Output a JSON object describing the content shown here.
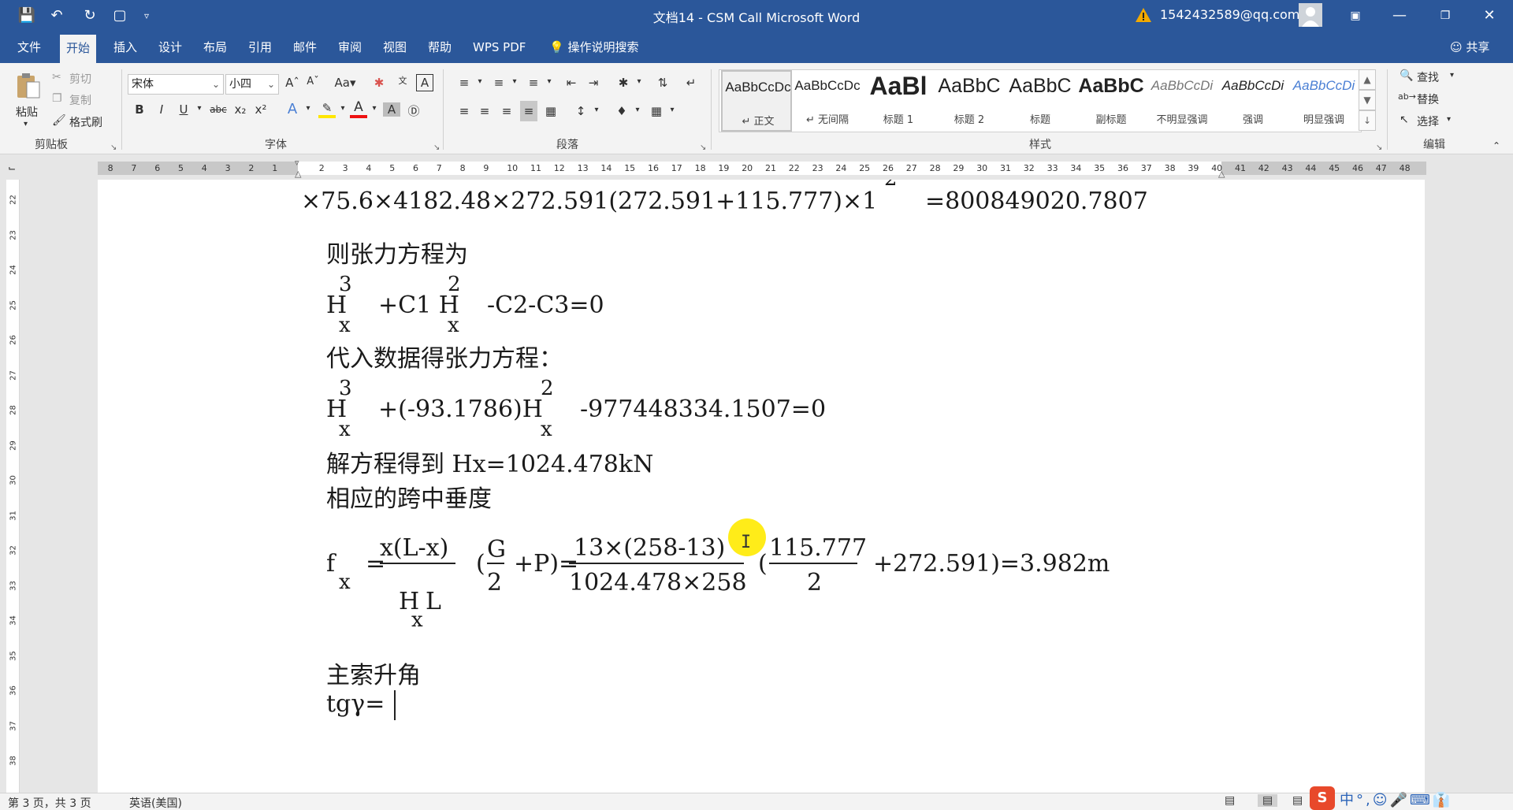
{
  "window": {
    "title": "文档14  -  CSM Call Microsoft Word",
    "account_email": "1542432589@qq.com",
    "quick_access": [
      "save",
      "undo",
      "redo",
      "new",
      "customize"
    ]
  },
  "ribbon_tabs": [
    "文件",
    "开始",
    "插入",
    "设计",
    "布局",
    "引用",
    "邮件",
    "审阅",
    "视图",
    "帮助",
    "WPS PDF"
  ],
  "active_tab": "开始",
  "tell_me": "操作说明搜索",
  "share": "共享",
  "clipboard": {
    "paste": "粘贴",
    "cut": "剪切",
    "copy": "复制",
    "format_painter": "格式刷",
    "label": "剪贴板"
  },
  "font": {
    "name": "宋体",
    "size": "小四",
    "label": "字体"
  },
  "paragraph": {
    "label": "段落"
  },
  "styles": {
    "label": "样式",
    "items": [
      {
        "sample": "AaBbCcDc",
        "name": "↵ 正文"
      },
      {
        "sample": "AaBbCcDc",
        "name": "↵ 无间隔"
      },
      {
        "sample": "AaBl",
        "name": "标题 1"
      },
      {
        "sample": "AaBbC",
        "name": "标题 2"
      },
      {
        "sample": "AaBbC",
        "name": "标题"
      },
      {
        "sample": "AaBbC",
        "name": "副标题"
      },
      {
        "sample": "AaBbCcDi",
        "name": "不明显强调"
      },
      {
        "sample": "AaBbCcDi",
        "name": "强调"
      },
      {
        "sample": "AaBbCcDi",
        "name": "明显强调"
      }
    ]
  },
  "editing": {
    "find": "查找",
    "replace": "替换",
    "select": "选择",
    "label": "编辑"
  },
  "ruler": {
    "h_left": [
      "8",
      "7",
      "6",
      "5",
      "4",
      "3",
      "2",
      "1"
    ],
    "h_right": [
      "2",
      "3",
      "4",
      "5",
      "6",
      "7",
      "8",
      "9",
      "10",
      "11",
      "12",
      "13",
      "14",
      "15",
      "16",
      "17",
      "18",
      "19",
      "20",
      "21",
      "22",
      "23",
      "24",
      "25",
      "26",
      "27",
      "28",
      "29",
      "30",
      "31",
      "32",
      "33",
      "34",
      "35",
      "36",
      "37",
      "38",
      "39",
      "40",
      "41",
      "42",
      "43",
      "44",
      "45",
      "46",
      "47",
      "48"
    ],
    "v": [
      "22",
      "23",
      "24",
      "25",
      "26",
      "27",
      "28",
      "29",
      "30",
      "31",
      "32",
      "33",
      "34",
      "35",
      "36",
      "37",
      "38"
    ]
  },
  "document": {
    "line_top": "×75.6×4182.48×272.591(272.591+115.777)×1",
    "line_top_sup": "2",
    "line_top_rhs": "=800849020.7807",
    "tension_title": "则张力方程为",
    "eq1": {
      "H": "H",
      "sup3": "3",
      "subx": "x",
      "mid": "+C1 H",
      "sup2": "2",
      "subx2": "x",
      "rest": "-C2-C3=0"
    },
    "substitute_title": "代入数据得张力方程：",
    "eq2": {
      "H": "H",
      "sup3": "3",
      "subx": "x",
      "mid": "+(-93.1786)H",
      "sup2": "2",
      "subx2": "x",
      "rest": "-977448334.1507=0"
    },
    "solution": "解方程得到 Hx=1024.478kN",
    "sag_title": "相应的跨中垂度",
    "sag": {
      "f": "f",
      "fsub": "x",
      "eq": "=",
      "num1": "x(L-x)",
      "den1": "H",
      "den1sub": "x",
      "den1tail": "L",
      "lp": "(",
      "g": "G",
      "two": "2",
      "plusP": "+P)=",
      "num2": "13×(258-13)",
      "den2": "1024.478×258",
      "lp2": "(",
      "num3": "115.777",
      "den3": "2",
      "tail": "+272.591)=3.982m"
    },
    "angle_title": "主索升角",
    "angle_line": "tgγ="
  },
  "status": {
    "page": "第 3 页，共 3 页",
    "language": "英语(美国)"
  },
  "ime": {
    "logo": "S",
    "items": "中°,☺🎤⌨👔"
  }
}
